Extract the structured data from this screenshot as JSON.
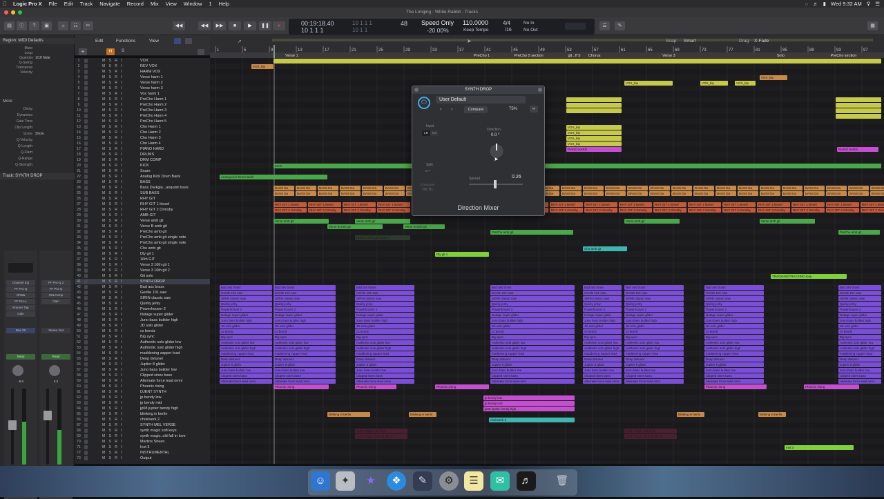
{
  "menubar": {
    "app": "Logic Pro X",
    "items": [
      "File",
      "Edit",
      "Track",
      "Navigate",
      "Record",
      "Mix",
      "View",
      "Window",
      "1",
      "Help"
    ],
    "clock": "Wed 9:32 AM"
  },
  "window": {
    "title": "The Longing - White Rabbit - Tracks"
  },
  "lcd": {
    "time": "00:19:18.40",
    "bars": "10 1 1 1",
    "bars2": "10 1 1 1",
    "bars3": "10 1 1",
    "tempo_small": "48",
    "speed_label": "Speed Only",
    "speed_value": "-20.00%",
    "tempo": "110.0000",
    "tempo_mode": "Keep Tempo",
    "sig_top": "4/4",
    "sig_bottom": "/16",
    "in": "No In",
    "out": "No Out"
  },
  "inspector": {
    "region_header": "Region: MIDI Defaults",
    "rows": [
      {
        "label": "Mute:",
        "value": ""
      },
      {
        "label": "Loop:",
        "value": ""
      },
      {
        "label": "Quantize",
        "value": "1/16 Note"
      },
      {
        "label": "Q-Swing:",
        "value": ""
      },
      {
        "label": "Transpose:",
        "value": ""
      },
      {
        "label": "Velocity:",
        "value": ""
      }
    ],
    "more": "More",
    "more_rows": [
      {
        "label": "Delay:",
        "value": ""
      },
      {
        "label": "Dynamics:",
        "value": ""
      },
      {
        "label": "Gate Time:",
        "value": ""
      },
      {
        "label": "Clip Length:",
        "value": ""
      },
      {
        "label": "Score:",
        "value": "Show"
      },
      {
        "label": "Q-Velocity:",
        "value": ""
      },
      {
        "label": "Q-Length:",
        "value": ""
      },
      {
        "label": "Q-Flam:",
        "value": ""
      },
      {
        "label": "Q-Range:",
        "value": ""
      },
      {
        "label": "Q-Strength:",
        "value": ""
      }
    ],
    "track_header": "Track: SYNTH DROP",
    "strip1": {
      "slots": [
        "Channel EQ",
        "FF Pro-Q",
        "OhWa",
        "FF Pro-L",
        "Kramer Tap",
        "Gain"
      ],
      "send": "Bus 29",
      "name": "SYNTH DROP",
      "read": "Read",
      "vol": "-9.8",
      "vol2": "-16.1"
    },
    "strip2": {
      "slots": [
        "FF Pro-Q 2",
        "FF Pro-Q",
        "SSLComp",
        "Gain"
      ],
      "send": "Stereo Out",
      "name": "INSTRUMENTAL",
      "read": "Read",
      "vol": "0.0",
      "vol2": "-12.5"
    }
  },
  "trackbar": {
    "edit": "Edit",
    "functions": "Functions",
    "view": "View"
  },
  "tracks": [
    "VOX",
    "REV VOX",
    "HARM VOX",
    "Verse harm 1",
    "Verse harm 2",
    "Verse harm 3",
    "Vox harm 1",
    "PreCho Harm 1",
    "PreCho Harm 2",
    "PreCho Harm 3",
    "PreCho Harm 4",
    "PreCho Harm 5",
    "Cho Harm 1",
    "Cho Harm 2",
    "Cho Harm 3",
    "Cho Harm 4",
    "PIANO HARD",
    "DRUMS",
    "DRM COMP",
    "KICK",
    "Snare",
    "Analog Kick Drum Bank",
    "BASS",
    "Bass Darkgla...anquish bass",
    "SUB BASS",
    "RHY GIT",
    "RHY GIT 1 kiesel",
    "RHY GIT 2 Ormsby",
    "AMB GIT",
    "Verse amb git",
    "Verse B amb git",
    "PreCho amb git",
    "PreCho amb git single note",
    "PreCho amb git single note",
    "Cho amb git",
    "Dly git 1",
    "16th GIT",
    "Verse 3 16th git 1",
    "Verse 3 16th git 2",
    "Git solo",
    "SYNTH DROP",
    "Bad ass brass",
    "Gentle 101 saw",
    "SIRIN classic saw",
    "Quirky jerky",
    "Powerhoover 2",
    "Notage super glider",
    "Juno bass builder high",
    "JD solo glider",
    "cs bendz",
    "Big sync",
    "Authentic solo glider low",
    "Authentic solo glider high",
    "maddening zapper lead",
    "Deep detuner",
    "Jupiter 8 glider",
    "Juno bass builder low",
    "Clipped sines bass",
    "Alternate force lead omni",
    "Phoenix rising",
    "DJENT SYNTH",
    "jp bendy low",
    "jp bendy mid",
    "jp08 jupiter bendy high",
    "blinking in berlin",
    "choirwerk 2",
    "SYNTH MEL VERSE",
    "synth magic soft keys",
    "synth magic..old fall in love",
    "Martins Sheen",
    "Inst 3",
    "INSTRUMENTAL",
    "Output"
  ],
  "ruler": {
    "bars": [
      "1",
      "5",
      "9",
      "13",
      "17",
      "21",
      "25",
      "29",
      "33",
      "37",
      "41",
      "45",
      "49",
      "53",
      "57",
      "61",
      "65",
      "69",
      "73",
      "77",
      "81",
      "85",
      "89",
      "93",
      "97"
    ],
    "markers": [
      "Verse 1",
      "PreCho 1",
      "PreCho 5 section",
      "git...ff 5",
      "Chorus",
      "Verse 3",
      "Solo",
      "PreCho section"
    ],
    "snap_label": "Snap:",
    "snap": "Smart",
    "drag_label": "Drag:",
    "drag": "X-Fade"
  },
  "regions": {
    "kick": "KICK",
    "analog": "Analog Kick Drum Bank",
    "bass": "BASS Da",
    "rhy1": "RHY GIT 1 kiesel",
    "rhy2": "RHY GIT 2 Ormsby",
    "verse_amb": "Verse amb git",
    "versb_amb": "Verse B amb git",
    "precho_amb": "PreCho amb git",
    "precho_single": "PreCho amb git single n",
    "cho_amb": "Cho amb git",
    "dly": "Dly git 1",
    "tracking": "TRACKING/TRACKING.loop",
    "phoenix": "Phoenix rising",
    "blinking": "blinking in berlin",
    "choirwerk": "choirwerk 2",
    "magic1": "synth magic soft keys",
    "magic2": "synth magic android fall in l",
    "piano": "PIANO HARD",
    "vox": "VOX_bip",
    "jp1": "jp bendy low",
    "jp2": "jp bendy mid",
    "jp3": "jp08 jupiter bendy high",
    "inst": "Inst 3",
    "synth_labels": [
      "Bad ass brass",
      "Gentle 101 saw",
      "SIRIN classic saw",
      "Quirky jerky",
      "Powerhoover 2",
      "Notage super glider",
      "Juno bass builder high",
      "JD solo glider",
      "cs bendz",
      "Big sync",
      "Authentic solo glider low",
      "Authentic solo glider high",
      "maddening zapper lead",
      "Deep detuner",
      "Jupiter 8 glider",
      "Juno bass builder low",
      "Clipped sines bass",
      "Alternate force lead omni"
    ]
  },
  "plugin": {
    "title": "SYNTH DROP",
    "preset": "User Default",
    "compare": "Compare",
    "zoom": "75%",
    "input_label": "Input",
    "input_lr": "LR",
    "input_ms": "MS",
    "direction_label": "Direction",
    "direction_value": "0.0 °",
    "split_label": "Split",
    "split_value": "OFF",
    "crossover_label": "Crossover",
    "crossover_value": "200 Hz",
    "spread_label": "Spread",
    "spread_value": "0.26",
    "name": "Direction Mixer"
  },
  "colors": {
    "yellow": "#c7c94a",
    "green": "#4aa84a",
    "orange": "#c78a4b",
    "red": "#c25a3b",
    "purple": "#7a4fd6",
    "magenta": "#c44fd0",
    "teal": "#3fb6b0",
    "lime": "#7fcf3f",
    "olive": "#8aa23a"
  }
}
